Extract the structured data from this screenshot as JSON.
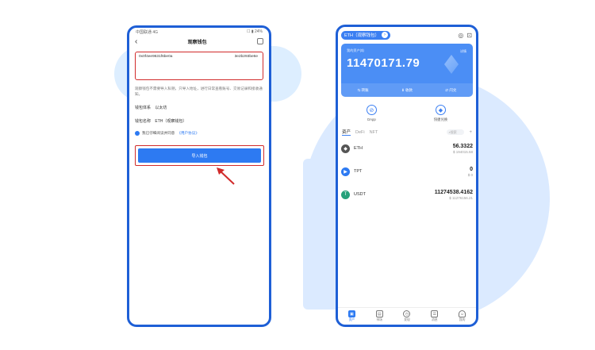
{
  "left": {
    "status_left": "中国联通 4G",
    "status_right": "☐ ▮ 24%",
    "title": "观察钱包",
    "address_start": "0x0f4ee9631f6be0a",
    "address_end": "3e2b293be6e",
    "hint": "观察钱包不需要导入私钥，只导入地址，进行日常查看账号、交易记录和接收通知。",
    "system_label": "钱包体系",
    "system_value": "以太坊",
    "name_label": "钱包名称",
    "name_value": "ETH（观察钱包）",
    "agree_text": "我已仔细阅读并同意",
    "agree_link": "《用户协议》",
    "import_label": "导入钱包"
  },
  "right": {
    "wallet_name": "ETH（观察钱包）",
    "balance_label": "我的资产($)",
    "balance": "11470171.79",
    "card_tag": "详情",
    "actions": [
      "转账",
      "收款",
      "闪兑"
    ],
    "quick": [
      {
        "label": "DApp",
        "icon": "⊘"
      },
      {
        "label": "快捷兑换",
        "icon": "◆"
      }
    ],
    "tabs": [
      "资产",
      "DeFi",
      "NFT"
    ],
    "search_placeholder": "搜索",
    "assets": [
      {
        "name": "ETH",
        "amount": "56.3322",
        "usd": "$ 194015.58",
        "color": "#555555",
        "icon": "◆"
      },
      {
        "name": "TPT",
        "amount": "0",
        "usd": "$ 0",
        "color": "#2d7af2",
        "icon": "▶"
      },
      {
        "name": "USDT",
        "amount": "11274538.4162",
        "usd": "$ 11276156.21",
        "color": "#26a17b",
        "icon": "T"
      }
    ],
    "nav": [
      "资产",
      "市场",
      "发现",
      "消息",
      "我的"
    ]
  },
  "colors": {
    "accent": "#2d7af2",
    "highlight": "#d12a2a"
  }
}
